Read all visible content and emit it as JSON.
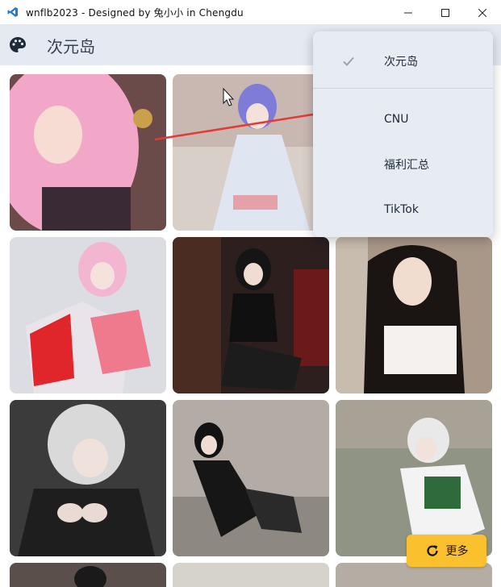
{
  "window": {
    "title": "wnflb2023 - Designed by 兔小小 in Chengdu"
  },
  "header": {
    "title": "次元岛",
    "icon": "palette-icon"
  },
  "menu": {
    "items": [
      {
        "label": "次元岛",
        "selected": true
      },
      {
        "label": "CNU",
        "selected": false
      },
      {
        "label": "福利汇总",
        "selected": false
      },
      {
        "label": "TikTok",
        "selected": false
      }
    ]
  },
  "gallery": {
    "tiles": [
      {
        "name": "pink-hair-cosplay",
        "color": "#e8a0c0"
      },
      {
        "name": "blue-hair-kimono-cosplay",
        "color": "#c9c2cf"
      },
      {
        "name": "hidden-tile",
        "color": "#d9cfc8"
      },
      {
        "name": "pink-hair-mecha-cosplay",
        "color": "#d7d9e0"
      },
      {
        "name": "black-leotard-cosplay",
        "color": "#3a2a2c"
      },
      {
        "name": "white-top-portrait",
        "color": "#b7a89a"
      },
      {
        "name": "white-hair-black-dress",
        "color": "#4a4a4a"
      },
      {
        "name": "black-dress-outdoor",
        "color": "#9a9490"
      },
      {
        "name": "white-hair-garden",
        "color": "#9aa08e"
      }
    ]
  },
  "actions": {
    "more_label": "更多"
  },
  "colors": {
    "accent": "#fbc02d",
    "header_bg": "#e5e9f1",
    "menu_bg": "#e7ecf3",
    "annotation": "#e53935"
  }
}
